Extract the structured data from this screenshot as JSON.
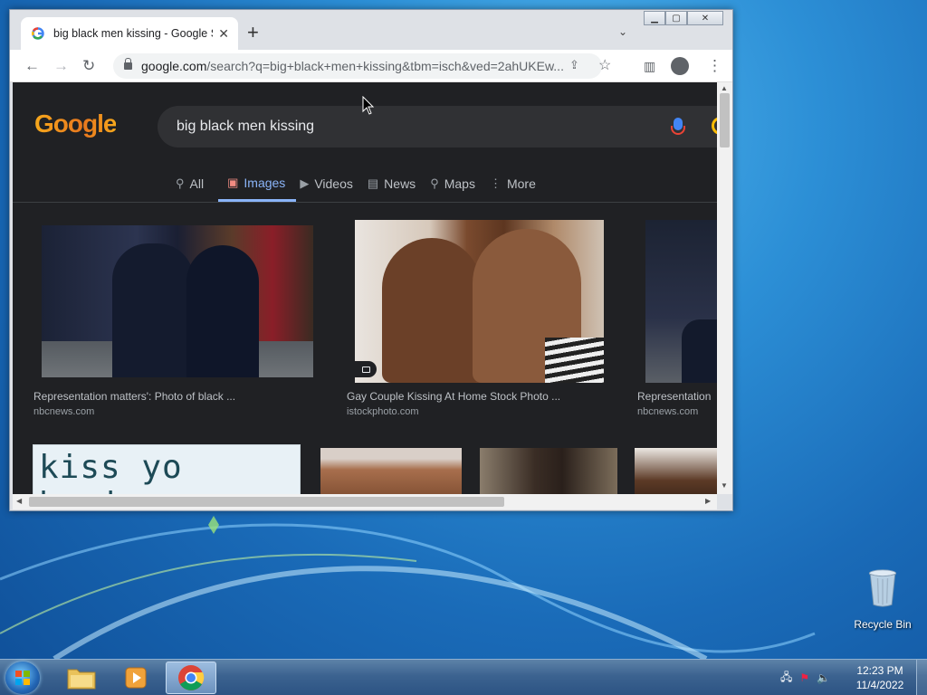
{
  "browser": {
    "tab_title": "big black men kissing - Google S",
    "new_tab_symbol": "+",
    "url_host": "google.com",
    "url_path": "/search?q=big+black+men+kissing&tbm=isch&ved=2ahUKEw..."
  },
  "google": {
    "logo_text": "Google",
    "query": "big black men kissing",
    "tabs": [
      {
        "label": "All",
        "icon": "search-icon"
      },
      {
        "label": "Images",
        "icon": "image-icon"
      },
      {
        "label": "Videos",
        "icon": "video-icon"
      },
      {
        "label": "News",
        "icon": "news-icon"
      },
      {
        "label": "Maps",
        "icon": "map-pin-icon"
      },
      {
        "label": "More",
        "icon": "more-vertical-icon"
      }
    ],
    "active_tab": "Images",
    "results": [
      {
        "caption": "Representation matters': Photo of black ...",
        "source": "nbcnews.com"
      },
      {
        "caption": "Gay Couple Kissing At Home Stock Photo ...",
        "source": "istockphoto.com"
      },
      {
        "caption": "Representation",
        "source": "nbcnews.com"
      }
    ],
    "row2_text": "kiss yo homies"
  },
  "desktop": {
    "recycle_bin_label": "Recycle Bin"
  },
  "taskbar": {
    "apps": [
      "windows-explorer",
      "media-player",
      "chrome"
    ],
    "active_app": "chrome",
    "time": "12:23 PM",
    "date": "11/4/2022"
  },
  "colors": {
    "google_dark_bg": "#202124",
    "active_tab_blue": "#8ab4f8",
    "desktop_blue": "#1a6bb8"
  }
}
